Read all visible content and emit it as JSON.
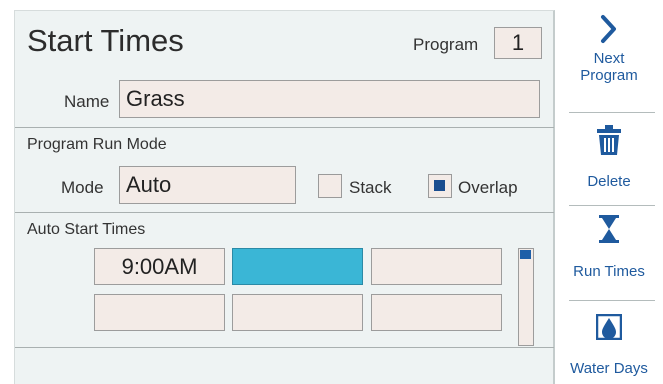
{
  "header": {
    "title": "Start Times",
    "program_label": "Program",
    "program_value": "1"
  },
  "name": {
    "label": "Name",
    "value": "Grass"
  },
  "run_mode": {
    "section_label": "Program Run Mode",
    "mode_label": "Mode",
    "mode_value": "Auto",
    "stack_label": "Stack",
    "stack_checked": false,
    "overlap_label": "Overlap",
    "overlap_checked": true
  },
  "auto_start": {
    "section_label": "Auto Start Times",
    "times": [
      "9:00AM",
      "",
      "",
      "",
      "",
      ""
    ],
    "selected_index": 1
  },
  "sidebar": {
    "next_label_1": "Next",
    "next_label_2": "Program",
    "delete_label": "Delete",
    "run_times_label": "Run Times",
    "water_days_label": "Water Days",
    "icons": [
      "chevron-right-icon",
      "trash-icon",
      "hourglass-icon",
      "water-drop-icon"
    ]
  },
  "colors": {
    "accent": "#1f5a9e",
    "selected_cell": "#3ab6d6",
    "field_bg": "#f3ebe7",
    "panel_bg": "#eef3f3"
  }
}
